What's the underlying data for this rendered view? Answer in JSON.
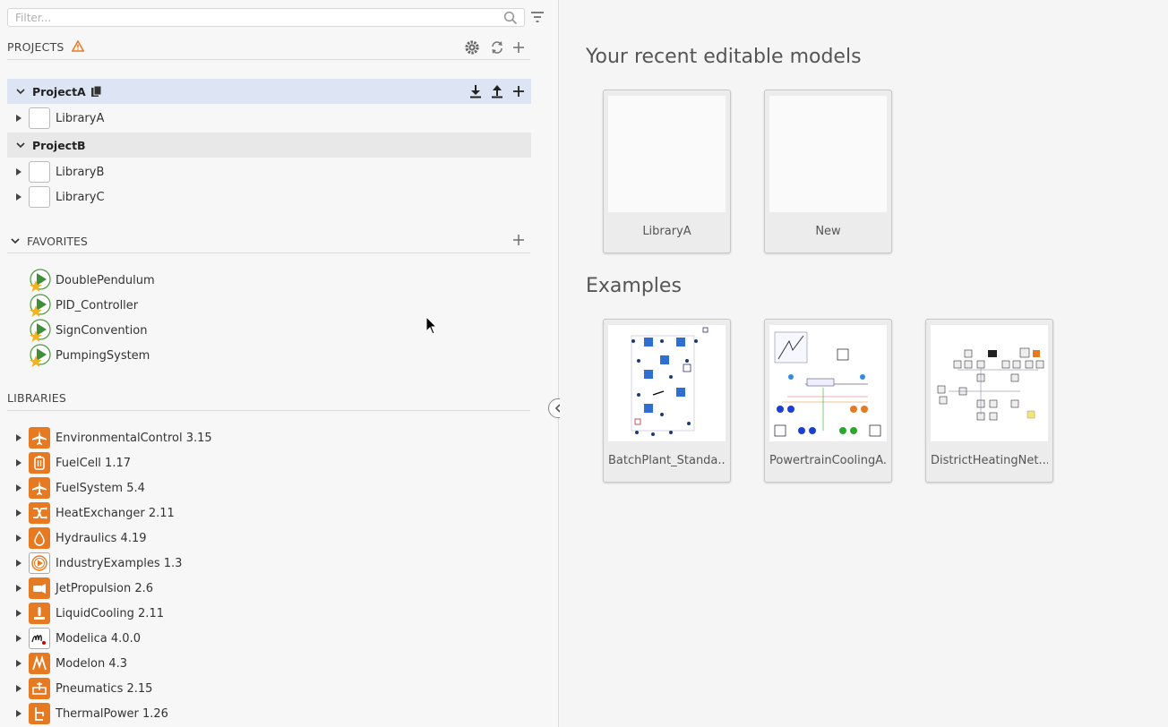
{
  "filter": {
    "placeholder": "Filter..."
  },
  "projects": {
    "title": "PROJECTS",
    "items": [
      {
        "name": "ProjectA",
        "libraries": [
          "LibraryA"
        ]
      },
      {
        "name": "ProjectB",
        "libraries": [
          "LibraryB",
          "LibraryC"
        ]
      }
    ]
  },
  "favorites": {
    "title": "FAVORITES",
    "items": [
      "DoublePendulum",
      "PID_Controller",
      "SignConvention",
      "PumpingSystem"
    ]
  },
  "libraries": {
    "title": "LIBRARIES",
    "items": [
      {
        "label": "EnvironmentalControl 3.15",
        "icon": "airplane-icon"
      },
      {
        "label": "FuelCell 1.17",
        "icon": "fuel-cell-icon"
      },
      {
        "label": "FuelSystem 5.4",
        "icon": "airplane-icon"
      },
      {
        "label": "HeatExchanger 2.11",
        "icon": "heat-exchanger-icon"
      },
      {
        "label": "Hydraulics 4.19",
        "icon": "droplet-icon"
      },
      {
        "label": "IndustryExamples 1.3",
        "icon": "play-icon"
      },
      {
        "label": "JetPropulsion 2.6",
        "icon": "jet-engine-icon"
      },
      {
        "label": "LiquidCooling 2.11",
        "icon": "thermometer-icon"
      },
      {
        "label": "Modelica 4.0.0",
        "icon": "modelica-icon"
      },
      {
        "label": "Modelon 4.3",
        "icon": "modelon-icon"
      },
      {
        "label": "Pneumatics 2.15",
        "icon": "pneumatics-icon"
      },
      {
        "label": "ThermalPower 1.26",
        "icon": "thermal-power-icon"
      }
    ]
  },
  "recent": {
    "title": "Your recent editable models",
    "cards": [
      "LibraryA",
      "New"
    ]
  },
  "examples": {
    "title": "Examples",
    "cards": [
      "BatchPlant_Standa...",
      "PowertrainCoolingA...",
      "DistrictHeatingNet..."
    ]
  },
  "colors": {
    "accent": "#e57a22",
    "selected": "#dde4f3",
    "warning": "#e57a22"
  }
}
